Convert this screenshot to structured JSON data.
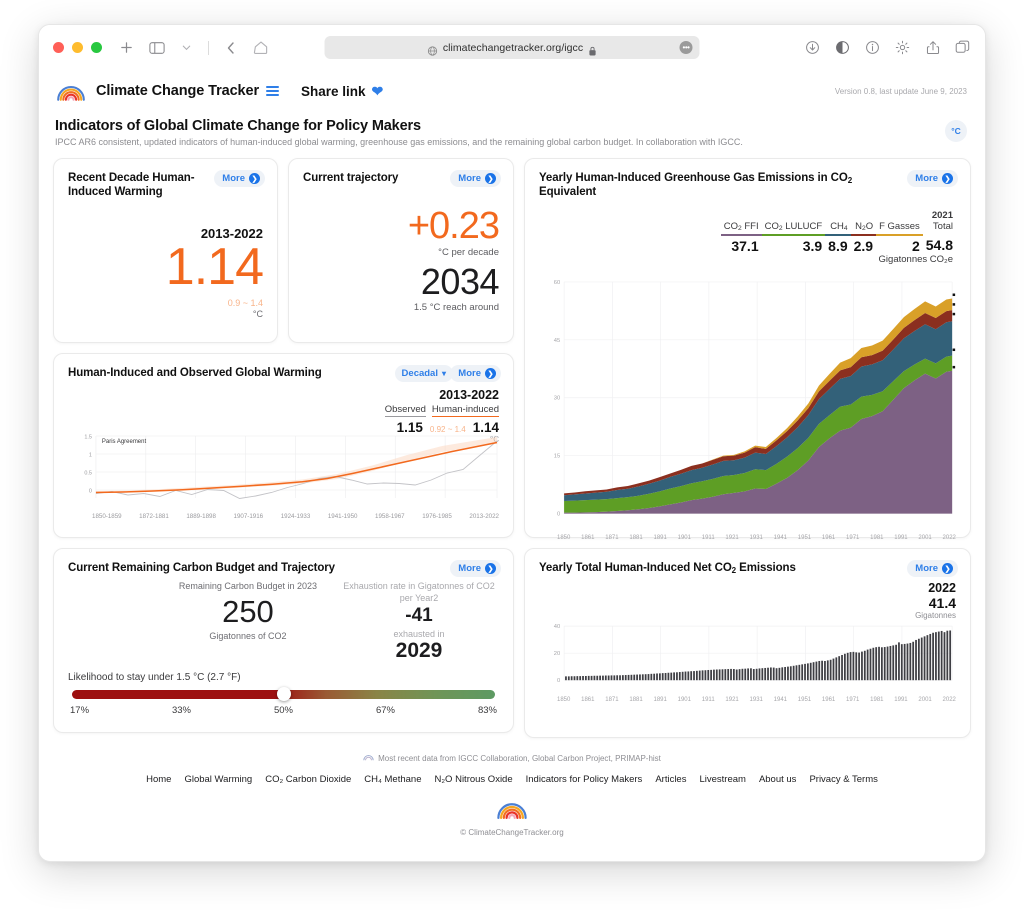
{
  "browser": {
    "url": "climatechangetracker.org/igcc",
    "toolbar_icons": [
      "new-tab-icon",
      "sidebar-icon",
      "chevron-down-icon",
      "back-icon",
      "home-icon"
    ],
    "right_icons": [
      "download-icon",
      "reader-icon",
      "info-icon",
      "gear-icon",
      "share-icon",
      "tabs-icon"
    ]
  },
  "site_header": {
    "brand": "Climate Change Tracker",
    "share_link": "Share link",
    "version": "Version 0.8, last update June 9, 2023"
  },
  "page": {
    "title": "Indicators of Global Climate Change for Policy Makers",
    "subtitle": "IPCC AR6 consistent, updated indicators of human-induced global warming, greenhouse gas emissions, and the remaining global carbon budget. In collaboration with IGCC.",
    "unit_toggle": "°C"
  },
  "labels": {
    "more": "More",
    "decadal": "Decadal"
  },
  "cards": {
    "recent_decade": {
      "title": "Recent Decade Human-Induced Warming",
      "period": "2013-2022",
      "value": "1.14",
      "range": "0.9 ~ 1.4",
      "unit": "°C"
    },
    "current_trajectory": {
      "title": "Current trajectory",
      "rate": "+0.23",
      "rate_unit": "°C per decade",
      "year": "2034",
      "year_label": "1.5 °C reach around"
    },
    "ghg": {
      "title_a": "Yearly Human-Induced Greenhouse Gas Emissions in CO",
      "title_sub": "2",
      "title_b": " Equivalent",
      "year": "2021",
      "total_label": "Total",
      "total_value": "54.8",
      "unit_note": "Gigatonnes CO₂e",
      "legend": [
        {
          "label_a": "CO",
          "label_sub": "2",
          "label_b": " FFI",
          "value": "37.1",
          "color": "#7d6184"
        },
        {
          "label_a": "CO",
          "label_sub": "2",
          "label_b": " LULUCF",
          "value": "3.9",
          "color": "#5e9e25"
        },
        {
          "label_a": "CH",
          "label_sub": "4",
          "label_b": "",
          "value": "8.9",
          "color": "#336179"
        },
        {
          "label_a": "N",
          "label_sub": "2",
          "label_b": "O",
          "value": "2.9",
          "color": "#8b2f1f"
        },
        {
          "label_a": "F Gasses",
          "label_sub": "",
          "label_b": "",
          "value": "2",
          "color": "#d9a028"
        }
      ]
    },
    "warming": {
      "title": "Human-Induced and Observed Global Warming",
      "period": "2013-2022",
      "observed_label": "Observed",
      "observed_value": "1.15",
      "human_label": "Human-induced",
      "human_value": "1.14",
      "range": "0.92 ~ 1.4",
      "unit": "°C",
      "annotation": "Paris Agreement"
    },
    "budget": {
      "title": "Current Remaining Carbon Budget and Trajectory",
      "budget_label": "Remaining Carbon Budget in 2023",
      "budget_value": "250",
      "budget_unit": "Gigatonnes of CO2",
      "rate_label": "Exhaustion rate in Gigatonnes of CO2 per Year2",
      "rate_value": "-41",
      "exhaust_label": "exhausted in",
      "exhaust_value": "2029",
      "likelihood_label": "Likelihood to stay under 1.5 °C (2.7 °F)",
      "ticks": [
        "17%",
        "33%",
        "50%",
        "67%",
        "83%"
      ],
      "knob_percent": 50
    },
    "net_co2": {
      "title_a": "Yearly Total Human-Induced Net CO",
      "title_sub": "2",
      "title_b": " Emissions",
      "year": "2022",
      "value": "41.4",
      "unit": "Gigatonnes"
    }
  },
  "footer": {
    "source": "Most recent data from IGCC Collaboration, Global Carbon Project, PRIMAP-hist",
    "nav": [
      "Home",
      "Global Warming",
      "CO₂ Carbon Dioxide",
      "CH₄ Methane",
      "N₂O Nitrous Oxide",
      "Indicators for Policy Makers",
      "Articles",
      "Livestream",
      "About us",
      "Privacy & Terms"
    ],
    "copyright": "© ClimateChangeTracker.org"
  },
  "chart_data": [
    {
      "id": "ghg_stacked_area",
      "type": "area",
      "title": "Yearly Human-Induced Greenhouse Gas Emissions in CO2 Equivalent",
      "xlabel": "",
      "ylabel": "",
      "ylim": [
        0,
        60
      ],
      "yticks": [
        0,
        15,
        30,
        45,
        60
      ],
      "xticks": [
        "1850",
        "1861",
        "1871",
        "1881",
        "1891",
        "1901",
        "1911",
        "1921",
        "1931",
        "1941",
        "1951",
        "1961",
        "1971",
        "1981",
        "1991",
        "2001",
        "2022"
      ],
      "xlim": [
        1850,
        2022
      ],
      "grid": true,
      "legend_position": "top-right",
      "x": [
        1850,
        1855,
        1860,
        1865,
        1870,
        1875,
        1880,
        1885,
        1890,
        1895,
        1900,
        1905,
        1910,
        1915,
        1920,
        1925,
        1930,
        1935,
        1940,
        1945,
        1950,
        1955,
        1960,
        1965,
        1970,
        1975,
        1980,
        1985,
        1990,
        1995,
        2000,
        2005,
        2010,
        2015,
        2019,
        2020,
        2021
      ],
      "series": [
        {
          "name": "CO2 FFI",
          "color": "#7d6184",
          "values": [
            0.2,
            0.2,
            0.2,
            0.3,
            0.4,
            0.5,
            0.7,
            0.8,
            1.0,
            1.3,
            1.8,
            2.2,
            2.8,
            2.9,
            3.3,
            3.6,
            3.6,
            3.8,
            4.5,
            4.2,
            5.5,
            6.8,
            8.8,
            11.0,
            14.5,
            16.8,
            18.8,
            19.5,
            21.8,
            22.5,
            24.0,
            28.0,
            32.5,
            35.0,
            37.0,
            35.5,
            37.1
          ]
        },
        {
          "name": "CO2 LULUCF",
          "color": "#5e9e25",
          "values": [
            3.0,
            3.1,
            3.2,
            3.2,
            3.3,
            3.4,
            3.5,
            3.6,
            3.8,
            4.0,
            4.2,
            4.3,
            4.5,
            4.6,
            4.7,
            4.8,
            4.6,
            4.8,
            5.0,
            4.8,
            5.2,
            5.5,
            5.7,
            5.9,
            6.0,
            6.0,
            6.2,
            6.0,
            5.8,
            5.5,
            5.2,
            4.8,
            4.4,
            4.1,
            3.9,
            3.9,
            3.9
          ]
        },
        {
          "name": "CH4",
          "color": "#336179",
          "values": [
            1.5,
            1.6,
            1.7,
            1.8,
            1.9,
            2.1,
            2.2,
            2.4,
            2.6,
            2.8,
            3.0,
            3.2,
            3.4,
            3.5,
            3.7,
            3.9,
            3.8,
            4.0,
            4.3,
            4.2,
            4.6,
            5.0,
            5.4,
            5.9,
            6.4,
            6.8,
            7.2,
            7.4,
            7.8,
            7.9,
            8.0,
            8.2,
            8.5,
            8.7,
            8.9,
            8.8,
            8.9
          ]
        },
        {
          "name": "N2O",
          "color": "#8b2f1f",
          "values": [
            0.5,
            0.5,
            0.6,
            0.6,
            0.6,
            0.7,
            0.7,
            0.8,
            0.8,
            0.9,
            0.9,
            1.0,
            1.1,
            1.1,
            1.2,
            1.2,
            1.2,
            1.3,
            1.4,
            1.3,
            1.5,
            1.6,
            1.7,
            1.8,
            2.0,
            2.1,
            2.2,
            2.3,
            2.4,
            2.4,
            2.5,
            2.6,
            2.7,
            2.8,
            2.9,
            2.9,
            2.9
          ]
        },
        {
          "name": "F Gasses",
          "color": "#d9a028",
          "values": [
            0.0,
            0.0,
            0.0,
            0.0,
            0.0,
            0.0,
            0.0,
            0.0,
            0.0,
            0.0,
            0.0,
            0.0,
            0.0,
            0.0,
            0.0,
            0.0,
            0.0,
            0.0,
            0.1,
            0.1,
            0.1,
            0.2,
            0.3,
            0.4,
            0.6,
            0.8,
            1.0,
            1.2,
            1.4,
            1.5,
            1.6,
            1.7,
            1.8,
            1.9,
            2.0,
            2.0,
            2.0
          ]
        }
      ]
    },
    {
      "id": "warming_line",
      "type": "line",
      "title": "Human-Induced and Observed Global Warming",
      "ylim": [
        -0.25,
        1.5
      ],
      "yticks": [
        0,
        0.5,
        1,
        1.5
      ],
      "xticks": [
        "1850-1859",
        "1872-1881",
        "1889-1898",
        "1907-1916",
        "1924-1933",
        "1941-1950",
        "1958-1967",
        "1976-1985",
        "2013-2022"
      ],
      "annotation": "Paris Agreement",
      "grid": true,
      "series": [
        {
          "name": "Human-induced",
          "color": "#f2691e",
          "values": [
            -0.02,
            -0.02,
            -0.01,
            0.0,
            0.01,
            0.02,
            0.03,
            0.04,
            0.05,
            0.06,
            0.08,
            0.1,
            0.12,
            0.14,
            0.16,
            0.18,
            0.2,
            0.22,
            0.25,
            0.32,
            0.42,
            0.55,
            0.7,
            0.85,
            1.0,
            1.1,
            1.15
          ]
        },
        {
          "name": "Observed",
          "color": "#b8b8bc",
          "values": [
            -0.04,
            0.0,
            -0.08,
            -0.05,
            -0.1,
            0.02,
            -0.06,
            0.04,
            0.02,
            -0.14,
            -0.1,
            0.0,
            0.1,
            0.18,
            0.3,
            0.35,
            0.28,
            0.2,
            0.22,
            0.21,
            0.18,
            0.28,
            0.42,
            0.5,
            0.72,
            0.95,
            1.15
          ]
        }
      ]
    },
    {
      "id": "net_co2_bars",
      "type": "bar",
      "title": "Yearly Total Human-Induced Net CO2 Emissions",
      "ylim": [
        0,
        45
      ],
      "yticks": [
        0,
        20,
        40
      ],
      "xticks": [
        "1850",
        "1861",
        "1871",
        "1881",
        "1891",
        "1901",
        "1911",
        "1921",
        "1931",
        "1941",
        "1951",
        "1961",
        "1971",
        "1981",
        "1991",
        "2001",
        "2022"
      ],
      "color": "#3f3f44",
      "values": [
        3.2,
        3.2,
        3.3,
        3.3,
        3.4,
        3.4,
        3.5,
        3.5,
        3.6,
        3.6,
        3.7,
        3.7,
        3.8,
        3.8,
        3.9,
        3.9,
        4.0,
        4.0,
        4.1,
        4.1,
        4.2,
        4.3,
        4.4,
        4.5,
        4.6,
        4.7,
        4.8,
        4.9,
        5.0,
        5.1,
        5.3,
        5.4,
        5.6,
        5.7,
        5.9,
        6.0,
        6.2,
        6.3,
        6.5,
        6.6,
        6.8,
        7.0,
        7.2,
        7.3,
        7.5,
        7.6,
        7.8,
        8.0,
        8.2,
        8.3,
        8.5,
        8.6,
        8.8,
        8.9,
        9.0,
        9.1,
        9.2,
        9.3,
        9.4,
        9.3,
        8.9,
        9.2,
        9.5,
        9.6,
        9.8,
        9.9,
        9.3,
        9.5,
        9.8,
        10.0,
        10.2,
        10.4,
        10.6,
        10.5,
        10.0,
        10.3,
        10.7,
        11.0,
        11.3,
        11.6,
        12.0,
        12.4,
        12.8,
        13.2,
        13.6,
        14.0,
        14.5,
        15.0,
        15.5,
        16.0,
        16.2,
        16.0,
        16.5,
        17.0,
        18.0,
        19.0,
        20.0,
        21.0,
        22.0,
        22.8,
        23.4,
        23.6,
        23.2,
        23.0,
        23.8,
        24.5,
        25.5,
        26.2,
        27.0,
        27.5,
        27.8,
        27.4,
        27.6,
        28.0,
        28.5,
        29.0,
        29.5,
        31.5,
        30.0,
        30.2,
        30.5,
        31.0,
        32.0,
        33.5,
        34.5,
        35.5,
        36.5,
        37.5,
        38.5,
        39.5,
        40.0,
        40.5,
        41.0,
        40.0,
        41.2,
        41.4
      ]
    }
  ]
}
